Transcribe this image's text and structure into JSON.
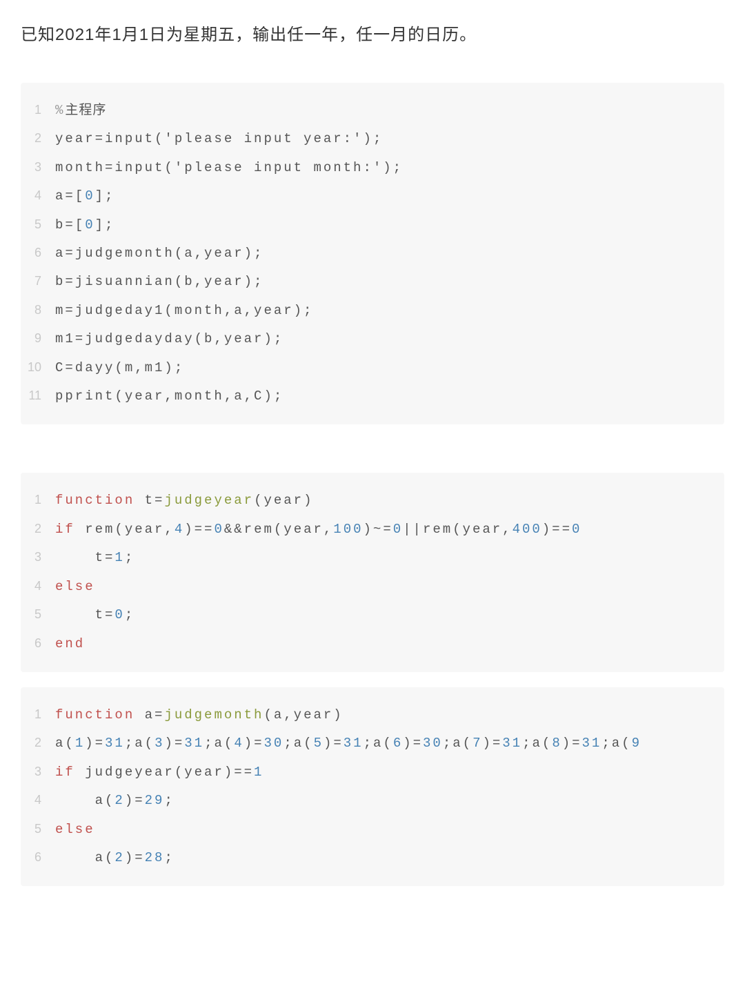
{
  "title": "已知2021年1月1日为星期五，输出任一年，任一月的日历。",
  "block1": {
    "l1": {
      "cmt_pct": "%",
      "cmt_text": "主程序"
    },
    "l2": "year=input('please input year:');",
    "l3": "month=input('please input month:');",
    "l4_1": "a=[",
    "l4_num": "0",
    "l4_2": "];",
    "l5_1": "b=[",
    "l5_num": "0",
    "l5_2": "];",
    "l6": "a=judgemonth(a,year);",
    "l7": "b=jisuannian(b,year);",
    "l8": "m=judgeday1(month,a,year);",
    "l9": "m1=judgedayday(b,year);",
    "l10": "C=dayy(m,m1);",
    "l11": "pprint(year,month,a,C);"
  },
  "block2": {
    "l1_fn_kw": "function",
    "l1_sp": " t=",
    "l1_fn": "judgeyear",
    "l1_rest": "(year)",
    "l2_kw": "if",
    "l2_1": " rem(year,",
    "l2_n4": "4",
    "l2_2": ")==",
    "l2_z1": "0",
    "l2_3": "&&rem(year,",
    "l2_n100": "100",
    "l2_4": ")~=",
    "l2_z2": "0",
    "l2_5": "||rem(year,",
    "l2_n400": "400",
    "l2_6": ")==",
    "l2_z3": "0",
    "l3_1": "    t=",
    "l3_n": "1",
    "l3_2": ";",
    "l4_kw": "else",
    "l5_1": "    t=",
    "l5_n": "0",
    "l5_2": ";",
    "l6_kw": "end"
  },
  "block3": {
    "l1_fn_kw": "function",
    "l1_sp": " a=",
    "l1_fn": "judgemonth",
    "l1_rest": "(a,year)",
    "l2_a": "a(",
    "l2_n1": "1",
    "l2_b": ")=",
    "l2_v1": "31",
    "l2_sc": ";a(",
    "l2_n3": "3",
    "l2_v3": "31",
    "l2_n4": "4",
    "l2_v4": "30",
    "l2_n5": "5",
    "l2_v5": "31",
    "l2_n6": "6",
    "l2_v6": "30",
    "l2_n7": "7",
    "l2_v7": "31",
    "l2_n8": "8",
    "l2_v8": "31",
    "l2_n9": "9",
    "l3_kw": "if",
    "l3_1": " judgeyear(year)==",
    "l3_n": "1",
    "l4_1": "    a(",
    "l4_n2": "2",
    "l4_2": ")=",
    "l4_v": "29",
    "l4_3": ";",
    "l5_kw": "else",
    "l6_1": "    a(",
    "l6_n2": "2",
    "l6_2": ")=",
    "l6_v": "28",
    "l6_3": ";"
  }
}
